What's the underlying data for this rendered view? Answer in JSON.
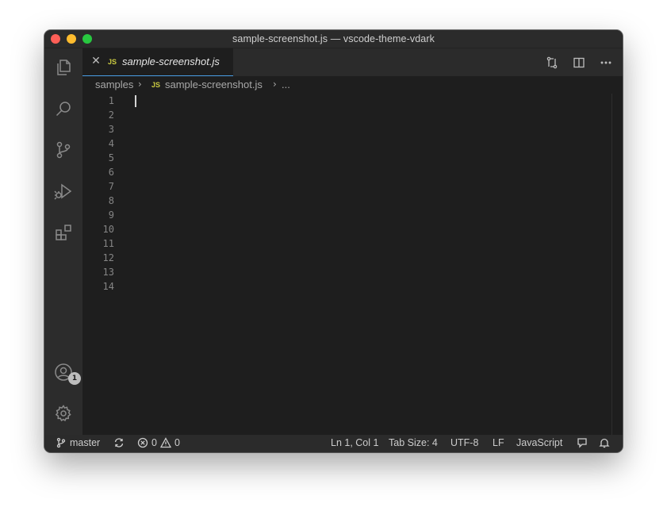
{
  "window": {
    "title": "sample-screenshot.js — vscode-theme-vdark"
  },
  "activity_bar": {
    "items": [
      "files-icon",
      "search-icon",
      "source-control-icon",
      "run-debug-icon",
      "extensions-icon"
    ],
    "account_badge": "1"
  },
  "tab": {
    "close": "✕",
    "lang_tag": "JS",
    "label": "sample-screenshot.js"
  },
  "breadcrumbs": {
    "folder": "samples",
    "lang_tag": "JS",
    "file": "sample-screenshot.js",
    "more": "..."
  },
  "editor": {
    "line_numbers": [
      "1",
      "2",
      "3",
      "4",
      "5",
      "6",
      "7",
      "8",
      "9",
      "10",
      "11",
      "12",
      "13",
      "14"
    ],
    "cursor": {
      "line": 1,
      "col": 1
    }
  },
  "statusbar": {
    "branch": "master",
    "errors": "0",
    "warnings": "0",
    "position": "Ln 1, Col 1",
    "tab_size": "Tab Size: 4",
    "encoding": "UTF-8",
    "eol": "LF",
    "language": "JavaScript"
  },
  "colors": {
    "keyword": "#d18ee0",
    "function": "#6ab0f3",
    "string": "#e0b865",
    "property": "#8fc97a",
    "boolean": "#f07178",
    "comment": "#7f7f7f",
    "tab_underline": "#4a9fe6"
  }
}
